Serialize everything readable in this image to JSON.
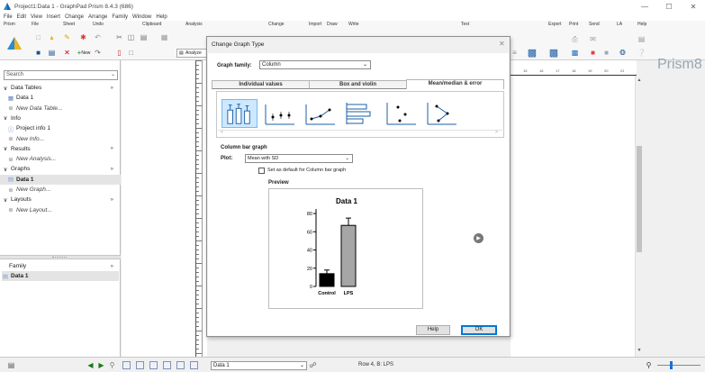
{
  "window": {
    "title": "Project1:Data 1 - GraphPad Prism 8.4.3 (686)"
  },
  "menu": [
    "File",
    "Edit",
    "View",
    "Insert",
    "Change",
    "Arrange",
    "Family",
    "Window",
    "Help"
  ],
  "ribbon": {
    "groups": [
      "Prism",
      "File",
      "Sheet",
      "Undo",
      "Clipboard",
      "Analysis",
      "Change",
      "Import",
      "Draw",
      "Write",
      "Text",
      "Export",
      "Print",
      "Send",
      "LA",
      "Help"
    ],
    "analyze": "Analyze",
    "new": "New",
    "brand": "Prism8"
  },
  "sidebar": {
    "search_placeholder": "Search",
    "items": [
      {
        "label": "Data Tables",
        "kind": "header"
      },
      {
        "label": "Data 1",
        "kind": "item"
      },
      {
        "label": "New Data Table...",
        "kind": "new"
      },
      {
        "label": "Info",
        "kind": "header"
      },
      {
        "label": "Project info 1",
        "kind": "item"
      },
      {
        "label": "New Info...",
        "kind": "new"
      },
      {
        "label": "Results",
        "kind": "header"
      },
      {
        "label": "New Analysis...",
        "kind": "new"
      },
      {
        "label": "Graphs",
        "kind": "header"
      },
      {
        "label": "Data 1",
        "kind": "selected"
      },
      {
        "label": "New Graph...",
        "kind": "new"
      },
      {
        "label": "Layouts",
        "kind": "header"
      },
      {
        "label": "New Layout...",
        "kind": "new"
      }
    ],
    "family_label": "Family",
    "family_item": "Data 1"
  },
  "ruler_top": [
    "15",
    "16",
    "17",
    "18",
    "19",
    "20",
    "21"
  ],
  "dialog": {
    "title": "Change Graph Type",
    "graph_family_label": "Graph family:",
    "graph_family_value": "Column",
    "tabs": [
      "Individual values",
      "Box and violin",
      "Mean/median & error"
    ],
    "active_tab": 2,
    "section_title": "Column bar graph",
    "plot_label": "Plot:",
    "plot_value": "Mean with SD",
    "default_checkbox": "Set as default for Column bar graph",
    "preview_label": "Preview",
    "help_button": "Help",
    "ok_button": "OK"
  },
  "chart_data": {
    "type": "bar",
    "title": "Data 1",
    "categories": [
      "Control",
      "LPS"
    ],
    "values": [
      14,
      67
    ],
    "errors": [
      4,
      8
    ],
    "colors": [
      "#000000",
      "#a6a6a6"
    ],
    "ylim": [
      0,
      85
    ],
    "yticks": [
      0,
      20,
      40,
      60,
      80
    ],
    "xlabel": "",
    "ylabel": ""
  },
  "statusbar": {
    "sheet": "Data 1",
    "row_info": "Row 4, B: LPS"
  }
}
